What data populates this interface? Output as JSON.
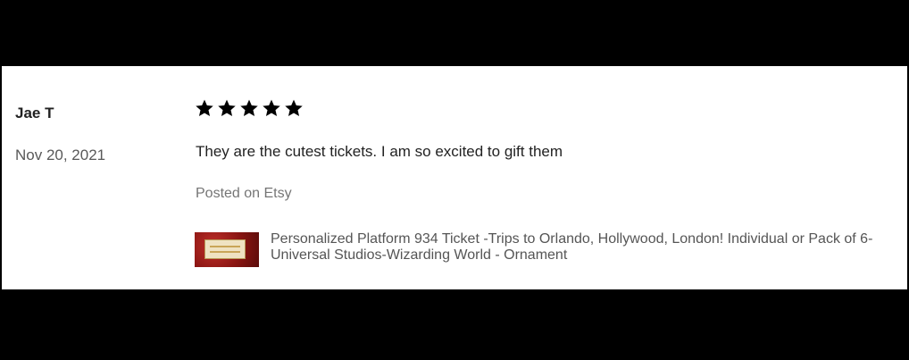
{
  "review": {
    "reviewer_name": "Jae T",
    "date": "Nov 20, 2021",
    "rating": 5,
    "rating_max": 5,
    "text": "They are the cutest tickets. I am so excited to gift them",
    "source": "Posted on Etsy"
  },
  "product": {
    "title": "Personalized Platform 934 Ticket -Trips to Orlando, Hollywood, London! Individual or Pack of 6- Universal Studios-Wizarding World - Ornament",
    "thumbnail_icon": "ticket-image"
  },
  "colors": {
    "background_bar": "#000000",
    "card": "#ffffff",
    "star": "#000000",
    "primary_text": "#222222",
    "muted_text": "#757575",
    "thumbnail_red": "#8a1512"
  }
}
